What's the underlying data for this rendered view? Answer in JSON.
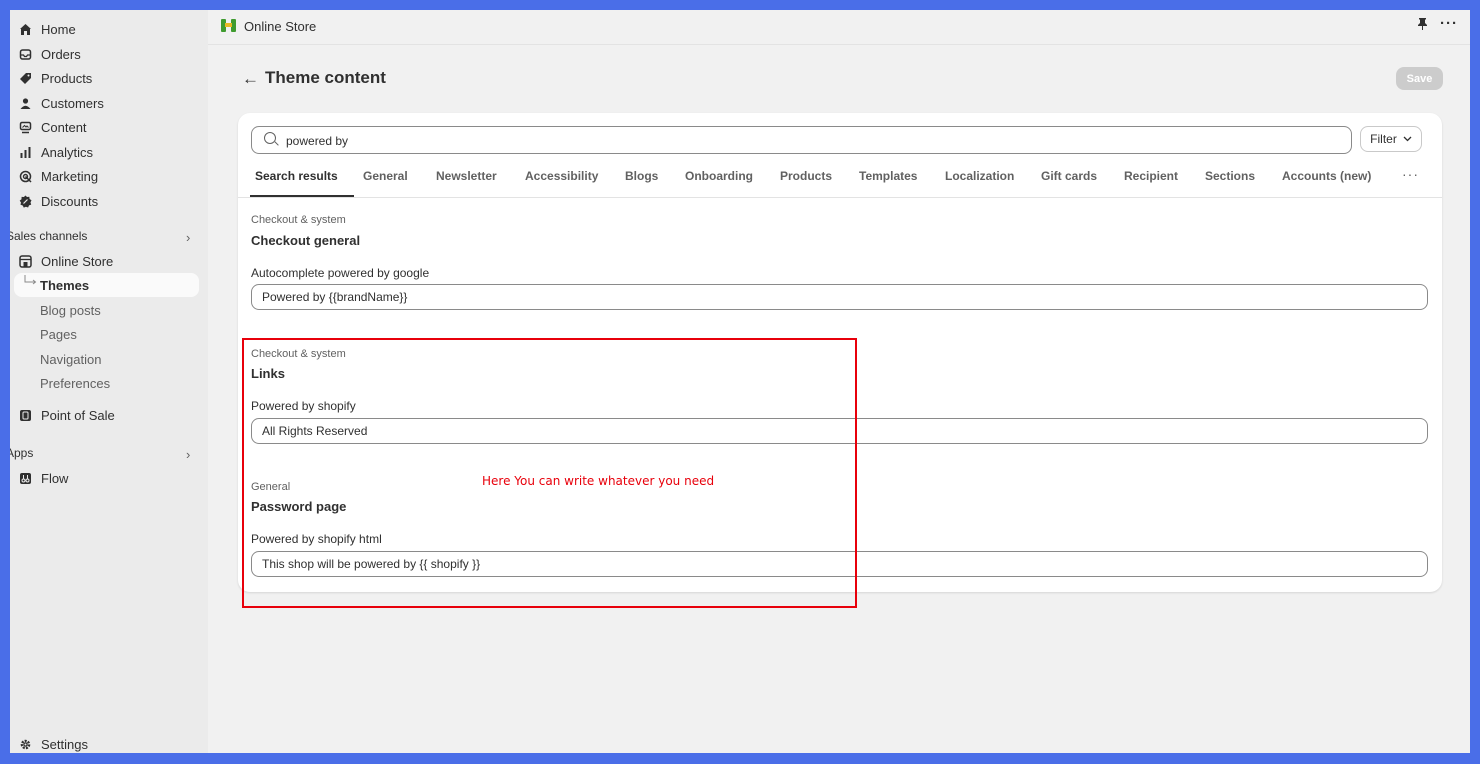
{
  "sidebar": {
    "items": [
      {
        "label": "Home",
        "icon": "home-icon"
      },
      {
        "label": "Orders",
        "icon": "inbox-icon"
      },
      {
        "label": "Products",
        "icon": "tag-icon"
      },
      {
        "label": "Customers",
        "icon": "person-icon"
      },
      {
        "label": "Content",
        "icon": "content-icon"
      },
      {
        "label": "Analytics",
        "icon": "bar-chart-icon"
      },
      {
        "label": "Marketing",
        "icon": "target-icon"
      },
      {
        "label": "Discounts",
        "icon": "discount-icon"
      }
    ],
    "sales_channels_label": "Sales channels",
    "online_store": "Online Store",
    "sub_items": [
      "Themes",
      "Blog posts",
      "Pages",
      "Navigation",
      "Preferences"
    ],
    "point_of_sale": "Point of Sale",
    "apps_label": "Apps",
    "flow": "Flow",
    "settings": "Settings"
  },
  "topbar": {
    "store_name": "Online Store"
  },
  "header": {
    "back": "←",
    "title": "Theme content",
    "save": "Save"
  },
  "search": {
    "value": "powered by",
    "filter": "Filter"
  },
  "tabs": [
    "Search results",
    "General",
    "Newsletter",
    "Accessibility",
    "Blogs",
    "Onboarding",
    "Products",
    "Templates",
    "Localization",
    "Gift cards",
    "Recipient",
    "Sections",
    "Accounts (new)"
  ],
  "groups": [
    {
      "category": "Checkout & system",
      "title": "Checkout general",
      "field_label": "Autocomplete powered by google",
      "field_value": "Powered by {{brandName}}"
    },
    {
      "category": "Checkout & system",
      "title": "Links",
      "field_label": "Powered by shopify",
      "field_value": "All Rights Reserved"
    },
    {
      "category": "General",
      "title": "Password page",
      "field_label": "Powered by shopify html",
      "field_value": "This shop will be powered by {{ shopify }}"
    }
  ],
  "annotation": "Here You can write whatever you need",
  "colors": {
    "accent": "#303030",
    "annotation": "#e8000b",
    "save_disabled": "#cccccc",
    "frame": "#4a6ee8"
  }
}
